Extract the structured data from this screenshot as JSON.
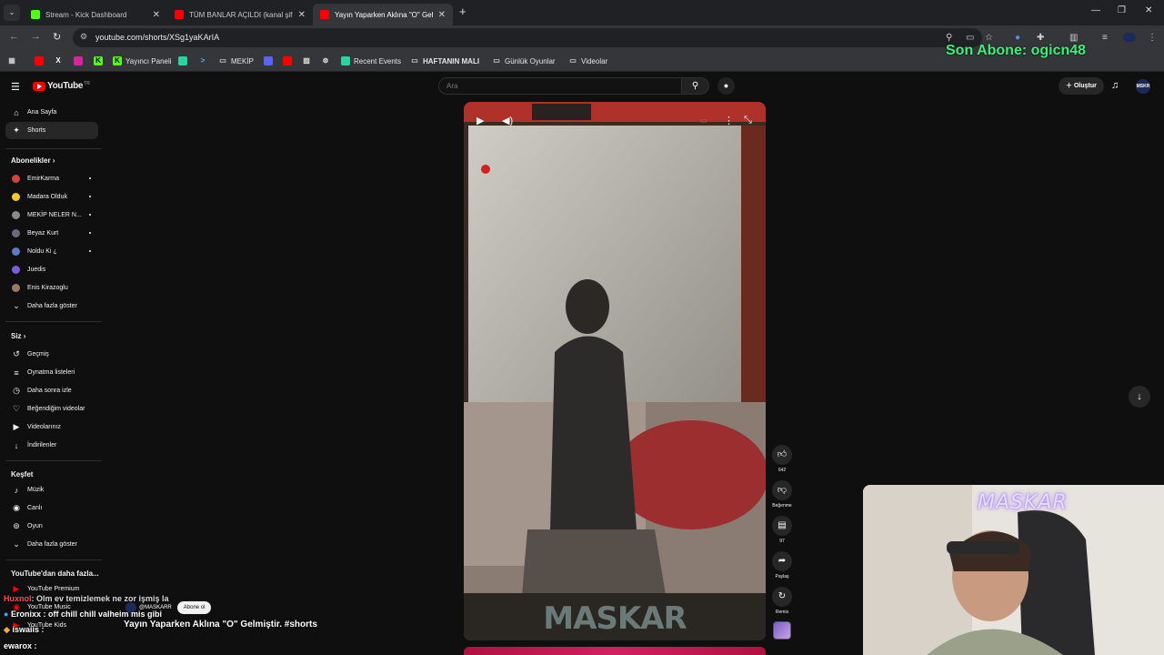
{
  "browser": {
    "tabs": [
      {
        "title": "Stream - Kick Dashboard",
        "fav_color": "#53fc18"
      },
      {
        "title": "TÜM BANLAR AÇILDI (kanal şifre...",
        "fav_color": "#ff0000"
      },
      {
        "title": "Yayın Yaparken Aklına \"O\" Gelmiştir...",
        "fav_color": "#ff0000"
      }
    ],
    "url": "youtube.com/shorts/XSg1yaKArIA",
    "bookmarks": [
      {
        "label": "Yayıncı Paneli"
      },
      {
        "label": "MEKİP"
      },
      {
        "label": "Recent Events"
      },
      {
        "label": "HAFTANIN MALI"
      },
      {
        "label": "Günlük Oyunlar"
      },
      {
        "label": "Videolar"
      }
    ]
  },
  "overlay": {
    "latest_sub": "Son Abone: ogicn48"
  },
  "header": {
    "logo_text": "YouTube",
    "logo_country": "TR",
    "search_placeholder": "Ara",
    "create_label": "Oluştur",
    "avatar_text": "MSKR"
  },
  "sidebar": {
    "main": [
      {
        "label": "Ana Sayfa",
        "icon": "home-icon"
      },
      {
        "label": "Shorts",
        "icon": "shorts-icon"
      }
    ],
    "subs_title": "Abonelikler",
    "subscriptions": [
      {
        "label": "EmirKarma",
        "color": "#d8403a"
      },
      {
        "label": "Madara Olduk",
        "color": "#f2c82c"
      },
      {
        "label": "MEKİP NELER N...",
        "color": "#8a8a8a"
      },
      {
        "label": "Beyaz Kurt",
        "color": "#6a6a7a"
      },
      {
        "label": "Noldu Ki ¿",
        "color": "#5b7bc9"
      },
      {
        "label": "Juedis",
        "color": "#7a5ce0"
      },
      {
        "label": "Enis Kirazoglu",
        "color": "#9a7a60"
      }
    ],
    "show_more": "Daha fazla göster",
    "you_title": "Siz",
    "you_items": [
      {
        "label": "Geçmiş"
      },
      {
        "label": "Oynatma listeleri"
      },
      {
        "label": "Daha sonra izle"
      },
      {
        "label": "Beğendiğim videolar"
      },
      {
        "label": "Videolarınız"
      },
      {
        "label": "İndirilenler"
      }
    ],
    "explore_title": "Keşfet",
    "explore_items": [
      {
        "label": "Müzik"
      },
      {
        "label": "Canlı"
      },
      {
        "label": "Oyun"
      }
    ],
    "explore_more": "Daha fazla göster",
    "more_title": "YouTube'dan daha fazla...",
    "more_items": [
      {
        "label": "YouTube Premium"
      },
      {
        "label": "YouTube Music"
      },
      {
        "label": "YouTube Kids"
      }
    ]
  },
  "short": {
    "title": "Yayın Yaparken Aklına \"O\" Gelmiştir. #shorts",
    "channel": "@MASKARR",
    "subscribe_label": "Abone ol",
    "likes": "642",
    "dislike_label": "Beğenme",
    "comments": "97",
    "share_label": "Paylaş",
    "remix_label": "Remix",
    "watermark": "MASKAR"
  },
  "chat": [
    {
      "user": "Huxnol",
      "text": ": Olm ev temizlemek ne zor işmiş la"
    },
    {
      "user": "Eronixx",
      "text": ": off chill chill valheim mis gibi"
    },
    {
      "user": "iswaiis",
      "text": ":"
    },
    {
      "user": "ewarox",
      "text": ":"
    }
  ],
  "webcam": {
    "logo": "MASKAR"
  }
}
